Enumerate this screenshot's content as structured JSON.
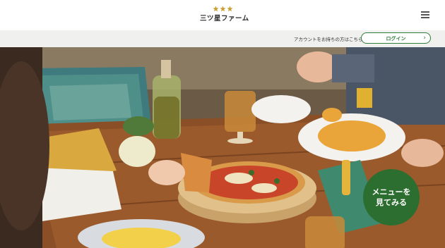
{
  "header": {
    "logo_text": "三ツ星ファーム",
    "logo_icon": "three-stars-logo",
    "menu_icon": "hamburger-menu-icon"
  },
  "account": {
    "prompt": "アカウントをお持ちの方はこちら",
    "login_label": "ログイン",
    "login_chevron": "›"
  },
  "cta": {
    "line1": "メニューを",
    "line2": "見てみる"
  },
  "colors": {
    "brand_green": "#2c6e2f",
    "star_gold": "#c8a030"
  }
}
